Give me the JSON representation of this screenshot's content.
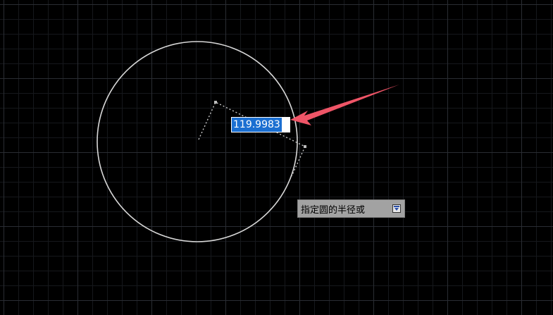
{
  "dynamic_input": {
    "radius_value": "119.9983"
  },
  "command_prompt": {
    "text": "指定圆的半径或",
    "options_icon": "dropdown-arrow-icon"
  },
  "colors": {
    "background": "#000000",
    "circle_stroke": "#d8d8d8",
    "highlight": "#1b6fd1",
    "annotation_arrow": "#ef5567"
  }
}
